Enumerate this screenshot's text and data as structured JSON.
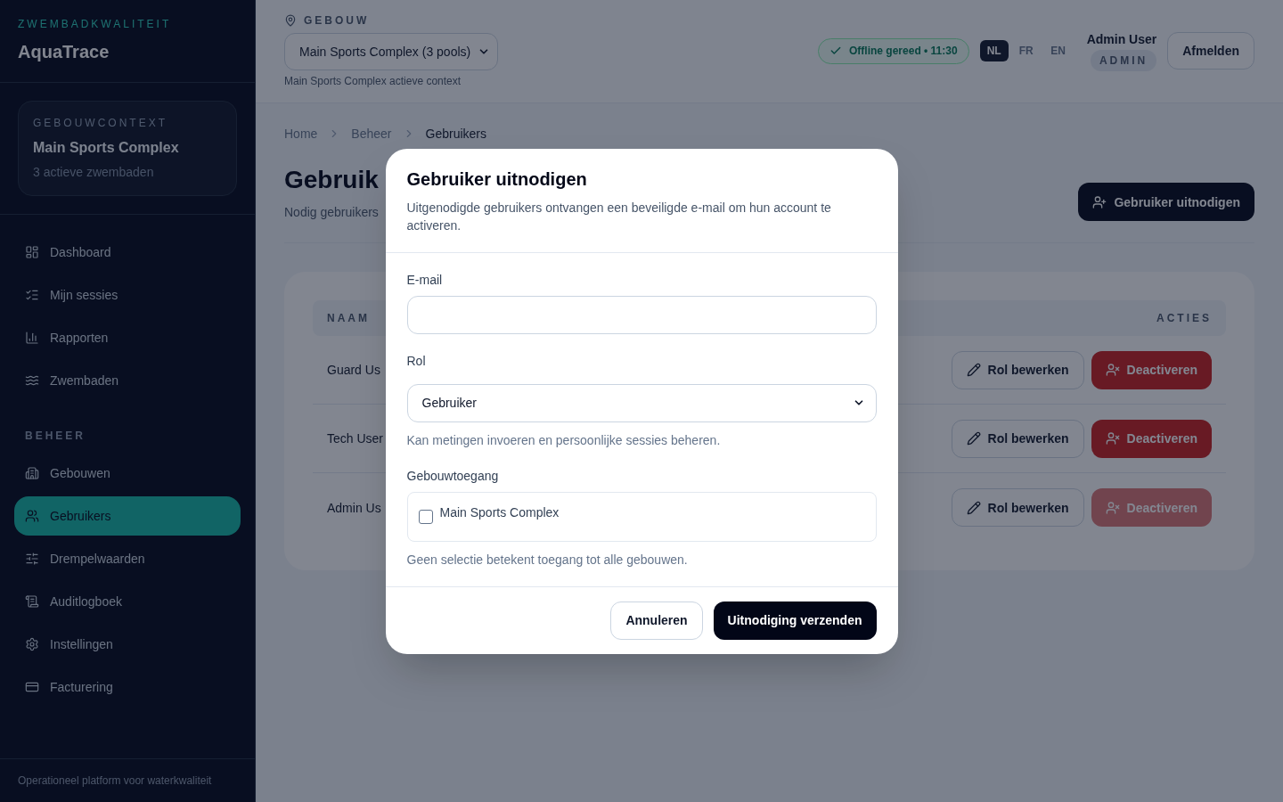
{
  "sidebar": {
    "eyebrow": "ZWEMBADKWALITEIT",
    "app_name": "AquaTrace",
    "context_card": {
      "label": "GEBOUWCONTEXT",
      "building": "Main Sports Complex",
      "subtitle": "3 actieve zwembaden"
    },
    "sections": [
      {
        "items": [
          {
            "label": "Dashboard",
            "selected": false
          },
          {
            "label": "Mijn sessies",
            "selected": false
          },
          {
            "label": "Rapporten",
            "selected": false
          },
          {
            "label": "Zwembaden",
            "selected": false
          }
        ]
      },
      {
        "title": "BEHEER",
        "items": [
          {
            "label": "Gebouwen",
            "selected": false
          },
          {
            "label": "Gebruikers",
            "selected": true
          },
          {
            "label": "Drempelwaarden",
            "selected": false
          },
          {
            "label": "Auditlogboek",
            "selected": false
          },
          {
            "label": "Instellingen",
            "selected": false
          },
          {
            "label": "Facturering",
            "selected": false
          }
        ]
      }
    ],
    "footer": "Operationeel platform voor waterkwaliteit"
  },
  "header": {
    "building_picker": {
      "label": "GEBOUW",
      "value": "Main Sports Complex (3 pools)",
      "caption": "Main Sports Complex actieve context"
    },
    "sync_status": "Offline gereed • 11:30",
    "languages": [
      {
        "label": "NL",
        "selected": true
      },
      {
        "label": "FR",
        "selected": false
      },
      {
        "label": "EN",
        "selected": false
      }
    ],
    "user": {
      "name": "Admin User",
      "role": "ADMIN"
    },
    "logout_button": "Afmelden"
  },
  "content": {
    "breadcrumb": [
      "Home",
      "Beheer",
      "Gebruikers"
    ],
    "title": "Gebruik",
    "subtitle": "Nodig gebruikers",
    "invite_button": "Gebruiker uitnodigen",
    "table": {
      "columns": [
        "NAAM",
        "ACTIES"
      ],
      "rows": [
        {
          "name": "Guard Us",
          "edit_button": "Rol bewerken",
          "deactivate_button": "Deactiveren",
          "deactivate_disabled": false
        },
        {
          "name": "Tech User",
          "edit_button": "Rol bewerken",
          "deactivate_button": "Deactiveren",
          "deactivate_disabled": false
        },
        {
          "name": "Admin Us",
          "edit_button": "Rol bewerken",
          "deactivate_button": "Deactiveren",
          "deactivate_disabled": true
        }
      ]
    }
  },
  "modal": {
    "title": "Gebruiker uitnodigen",
    "description": "Uitgenodigde gebruikers ontvangen een beveiligde e-mail om hun account te activeren.",
    "fields": [
      {
        "kind": "input",
        "label": "E-mail"
      },
      {
        "kind": "select",
        "label": "Rol",
        "value": "Gebruiker",
        "hint": "Kan metingen invoeren en persoonlijke sessies beheren."
      },
      {
        "kind": "checklist",
        "label": "Gebouwtoegang",
        "options": [
          {
            "label": "Main Sports Complex",
            "checked": false
          }
        ],
        "hint": "Geen selectie betekent toegang tot alle gebouwen."
      }
    ],
    "buttons": [
      {
        "kind": "secondary",
        "label": "Annuleren"
      },
      {
        "kind": "primary",
        "label": "Uitnodiging verzenden"
      }
    ]
  }
}
